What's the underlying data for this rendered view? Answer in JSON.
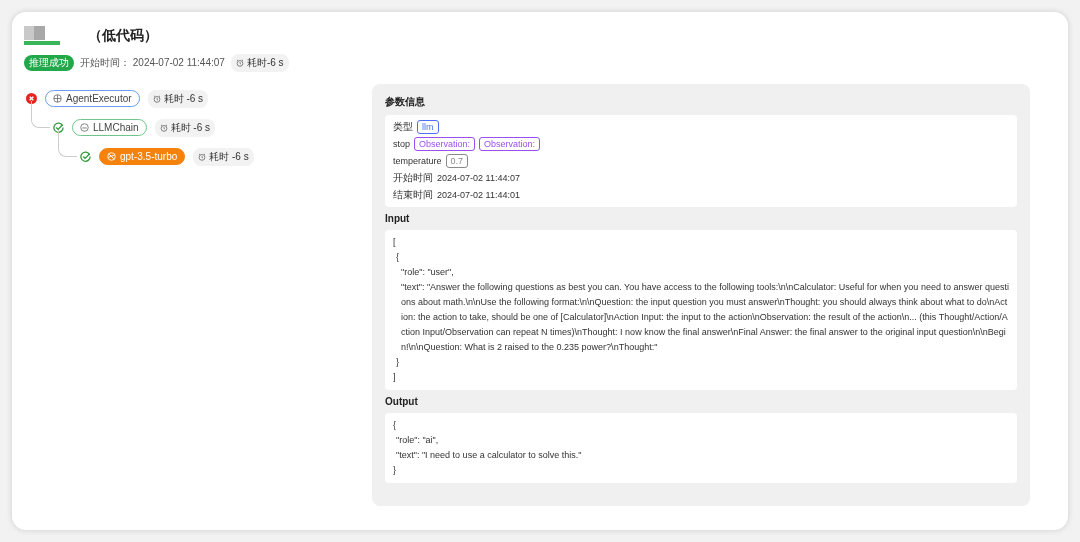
{
  "header": {
    "title": "（低代码）",
    "status": "推理成功",
    "start_label": "开始时间：",
    "start_time": "2024-07-02 11:44:07",
    "duration": "耗时-6 s"
  },
  "tree": [
    {
      "name": "AgentExecutor",
      "kind": "agent",
      "failed": true,
      "selected": false,
      "duration": "耗时 -6 s",
      "children": [
        {
          "name": "LLMChain",
          "kind": "chain",
          "failed": false,
          "selected": false,
          "duration": "耗时 -6 s",
          "children": [
            {
              "name": "gpt-3.5-turbo",
              "kind": "llm",
              "failed": false,
              "selected": true,
              "duration": "耗时 -6 s"
            }
          ]
        }
      ]
    }
  ],
  "details": {
    "params_title": "参数信息",
    "params": [
      {
        "label": "类型",
        "kind": "tags",
        "tags": [
          {
            "text": "llm",
            "color": "#4f6ef7"
          }
        ]
      },
      {
        "label": "stop",
        "kind": "tags",
        "tags": [
          {
            "text": "Observation:",
            "color": "#9b4ff0"
          },
          {
            "text": "Observation:",
            "color": "#9b4ff0"
          }
        ]
      },
      {
        "label": "temperature",
        "kind": "tags",
        "tags": [
          {
            "text": "0.7",
            "color": "#8a8a8a"
          }
        ]
      },
      {
        "label": "开始时间",
        "kind": "text",
        "value": "2024-07-02 11:44:07"
      },
      {
        "label": "结束时间",
        "kind": "text",
        "value": "2024-07-02 11:44:01"
      }
    ],
    "input_title": "Input",
    "input_lines": [
      "[",
      "{",
      "\"role\": \"user\",",
      "\"text\": \"Answer the following questions as best you can. You have access to the following tools:\\n\\nCalculator: Useful for when you need to answer questions about math.\\n\\nUse the following format:\\n\\nQuestion: the input question you must answer\\nThought: you should always think about what to do\\nAction: the action to take, should be one of [Calculator]\\nAction Input: the input to the action\\nObservation: the result of the action\\n... (this Thought/Action/Action Input/Observation can repeat N times)\\nThought: I now know the final answer\\nFinal Answer: the final answer to the original input question\\n\\nBegin!\\n\\nQuestion: What is 2 raised to the 0.235 power?\\nThought:\"",
      "}",
      "]"
    ],
    "output_title": "Output",
    "output_lines": [
      "{",
      "\"role\": \"ai\",",
      "\"text\": \"I need to use a calculator to solve this.\"",
      "}"
    ]
  }
}
